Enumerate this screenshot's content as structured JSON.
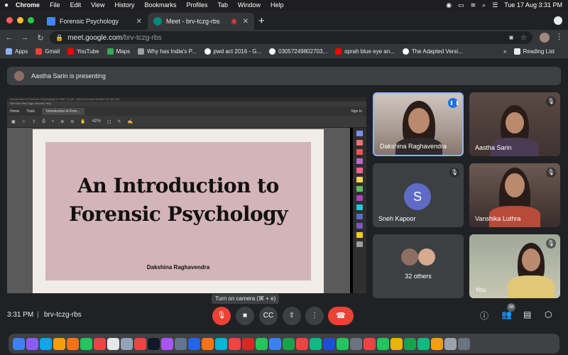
{
  "menubar": {
    "app": "Chrome",
    "items": [
      "File",
      "Edit",
      "View",
      "History",
      "Bookmarks",
      "Profiles",
      "Tab",
      "Window",
      "Help"
    ],
    "clock": "Tue 17 Aug  3:31 PM"
  },
  "tabs": [
    {
      "title": "Forensic Psychology",
      "active": false
    },
    {
      "title": "Meet - brv-tczg-rbs",
      "active": true
    }
  ],
  "address": {
    "host": "meet.google.com",
    "path": "/brv-tczg-rbs"
  },
  "bookmarks": [
    {
      "label": "Apps",
      "color": "#8ab4f8"
    },
    {
      "label": "Gmail",
      "color": "#ea4335"
    },
    {
      "label": "YouTube",
      "color": "#ff0000"
    },
    {
      "label": "Maps",
      "color": "#34a853"
    },
    {
      "label": "Why has India's P...",
      "color": "#9aa0a6"
    },
    {
      "label": "pwd act 2016 - G...",
      "color": "#ffffff"
    },
    {
      "label": "03057249802703...",
      "color": "#ffffff"
    },
    {
      "label": "oprah blue eye an...",
      "color": "#ff0000"
    },
    {
      "label": "The Adapted Versi...",
      "color": "#ffffff"
    }
  ],
  "bookmarks_more": "»",
  "reading_list": "Reading List",
  "presenting_banner": "Aastha Sarin is presenting",
  "shared_screen": {
    "acrobat_title": "Introduction to Forensic Psychology for ABC_D.pdf - Adobe Acrobat Reader DC (64-bit)",
    "acrobat_menu": "File  Edit  View  Sign  Window  Help",
    "tabs": [
      "Home",
      "Tools",
      "Introduction to Fore..."
    ],
    "sign_in": "Sign In",
    "zoom": "42%",
    "slide": {
      "title_line1": "An Introduction to",
      "title_line2": "Forensic Psychology",
      "author": "Dakshina Raghavendra"
    }
  },
  "participants": [
    {
      "name": "Dakshina Raghavendra",
      "speaking": true
    },
    {
      "name": "Aastha Sarin",
      "muted": true
    },
    {
      "name": "Sneh Kapoor",
      "initial": "S",
      "muted": true
    },
    {
      "name": "Vanshika Luthra",
      "muted": true
    },
    {
      "name": "32 others"
    },
    {
      "name": "You",
      "muted": true
    }
  ],
  "bottom_bar": {
    "time": "3:31 PM",
    "separator": "|",
    "meeting_code": "brv-tczg-rbs",
    "camera_tooltip": "Turn on camera (⌘ + e)",
    "participants_count": "38"
  },
  "dock_colors": [
    "#3b82f6",
    "#8b5cf6",
    "#0ea5e9",
    "#f59e0b",
    "#f97316",
    "#22c55e",
    "#ef4444",
    "#e5e7eb",
    "#94a3b8",
    "#ef4444",
    "#111827",
    "#a855f7",
    "#64748b",
    "#2563eb",
    "#f97316",
    "#06b6d4",
    "#ef4444",
    "#dc2626",
    "#22c55e",
    "#3b82f6",
    "#16a34a",
    "#ef4444",
    "#10b981",
    "#1d4ed8",
    "#22c55e",
    "#6b7280",
    "#ef4444",
    "#22c55e",
    "#eab308",
    "#16a34a",
    "#10b981",
    "#f59e0b",
    "#9ca3af",
    "#6b7280"
  ]
}
